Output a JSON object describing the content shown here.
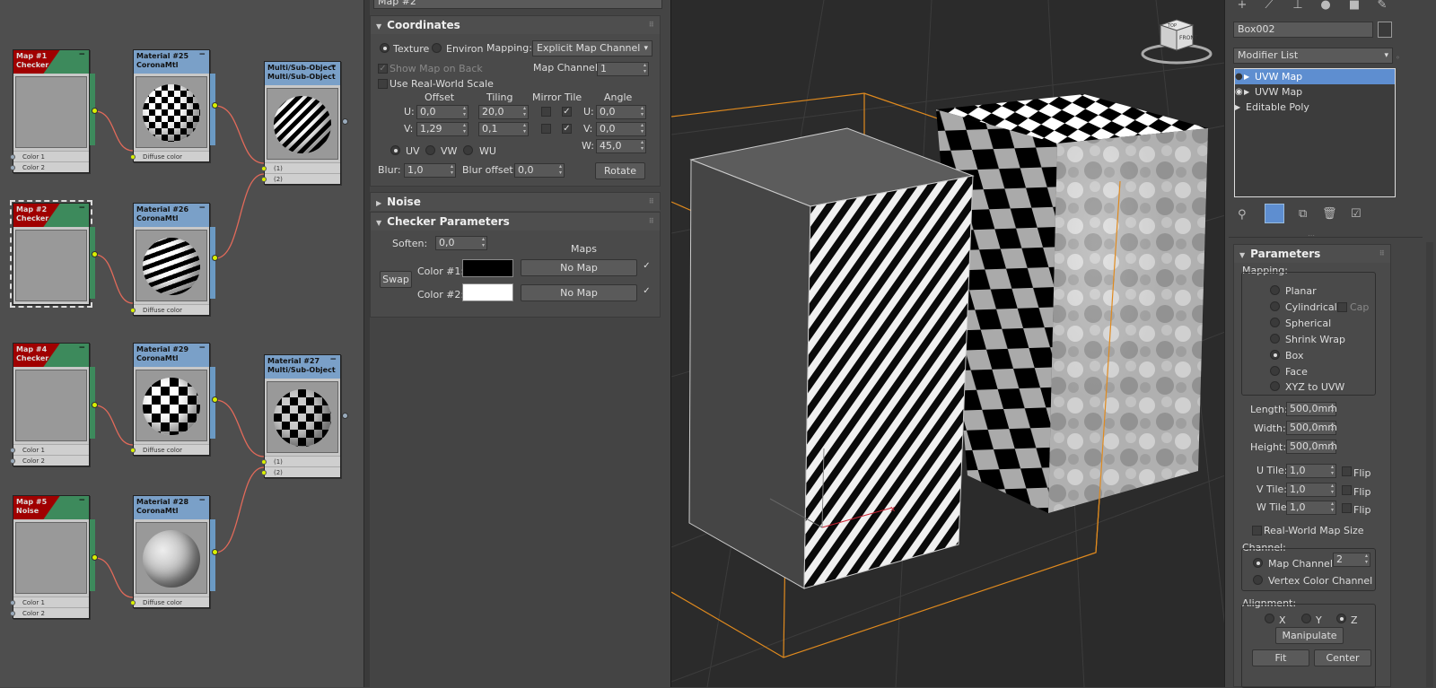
{
  "node_editor": {
    "nodes": [
      {
        "id": "map1",
        "title": "Map #1",
        "type": "Checker",
        "slots": [
          "Color 1",
          "Color 2"
        ]
      },
      {
        "id": "mat25",
        "title": "Material #25",
        "type": "CoronaMtl",
        "slots": [
          "Diffuse color"
        ]
      },
      {
        "id": "multi1",
        "title": "Multi/Sub-Object",
        "type": "Multi/Sub-Object",
        "slots": [
          "(1)",
          "(2)"
        ]
      },
      {
        "id": "map2",
        "title": "Map #2",
        "type": "Checker",
        "slots": []
      },
      {
        "id": "mat26",
        "title": "Material #26",
        "type": "CoronaMtl",
        "slots": [
          "Diffuse color"
        ]
      },
      {
        "id": "map4",
        "title": "Map #4",
        "type": "Checker",
        "slots": [
          "Color 1",
          "Color 2"
        ]
      },
      {
        "id": "mat29",
        "title": "Material #29",
        "type": "CoronaMtl",
        "slots": [
          "Diffuse color"
        ]
      },
      {
        "id": "mat27",
        "title": "Material #27",
        "type": "Multi/Sub-Object",
        "slots": [
          "(1)",
          "(2)"
        ]
      },
      {
        "id": "map5",
        "title": "Map #5",
        "type": "Noise",
        "slots": [
          "Color 1",
          "Color 2"
        ]
      },
      {
        "id": "mat28",
        "title": "Material #28",
        "type": "CoronaMtl",
        "slots": [
          "Diffuse color"
        ]
      }
    ]
  },
  "material_panel": {
    "title": "Map #2",
    "coordinates": {
      "heading": "Coordinates",
      "texture_label": "Texture",
      "environ_label": "Environ",
      "mapping_label": "Mapping:",
      "mapping_value": "Explicit Map Channel",
      "show_map_on_back": "Show Map on Back",
      "map_channel_label": "Map Channel:",
      "map_channel_value": "1",
      "use_real_world": "Use Real-World Scale",
      "col_offset": "Offset",
      "col_tiling": "Tiling",
      "col_mirror_tile": "Mirror Tile",
      "col_angle": "Angle",
      "u_label": "U:",
      "v_label": "V:",
      "w_label": "W:",
      "u_offset": "0,0",
      "v_offset": "1,29",
      "u_tiling": "20,0",
      "v_tiling": "0,1",
      "u_angle": "0,0",
      "v_angle": "0,0",
      "w_angle": "45,0",
      "uv_label": "UV",
      "vw_label": "VW",
      "wu_label": "WU",
      "blur_label": "Blur:",
      "blur_value": "1,0",
      "blur_offset_label": "Blur offset:",
      "blur_offset_value": "0,0",
      "rotate_label": "Rotate"
    },
    "noise": {
      "heading": "Noise"
    },
    "checker": {
      "heading": "Checker Parameters",
      "soften_label": "Soften:",
      "soften_value": "0,0",
      "maps_label": "Maps",
      "swap_label": "Swap",
      "color1_label": "Color #1:",
      "color2_label": "Color #2:",
      "color1": "#000000",
      "color2": "#ffffff",
      "no_map_1": "No Map",
      "no_map_2": "No Map"
    }
  },
  "viewport": {
    "viewcube_label": "FRONT",
    "viewcube_top_label": "TOP"
  },
  "command_panel": {
    "object_name": "Box002",
    "modifier_list": "Modifier List",
    "stack": [
      "UVW Map",
      "UVW Map",
      "Editable Poly"
    ],
    "parameters": {
      "heading": "Parameters",
      "mapping_label": "Mapping:",
      "options": [
        "Planar",
        "Cylindrical",
        "Spherical",
        "Shrink Wrap",
        "Box",
        "Face",
        "XYZ to UVW"
      ],
      "selected_option": "Box",
      "cap_label": "Cap",
      "length_label": "Length:",
      "length_value": "500,0mm",
      "width_label": "Width:",
      "width_value": "500,0mm",
      "height_label": "Height:",
      "height_value": "500,0mm",
      "u_tile_label": "U Tile:",
      "u_tile_value": "1,0",
      "v_tile_label": "V Tile:",
      "v_tile_value": "1,0",
      "w_tile_label": "W Tile:",
      "w_tile_value": "1,0",
      "flip_label": "Flip",
      "real_world_label": "Real-World Map Size",
      "channel_label": "Channel:",
      "map_channel_label": "Map Channel:",
      "map_channel_value": "2",
      "vertex_color_label": "Vertex Color Channel",
      "alignment_label": "Alignment:",
      "x_label": "X",
      "y_label": "Y",
      "z_label": "Z",
      "manipulate_label": "Manipulate",
      "fit_label": "Fit",
      "center_label": "Center"
    }
  }
}
